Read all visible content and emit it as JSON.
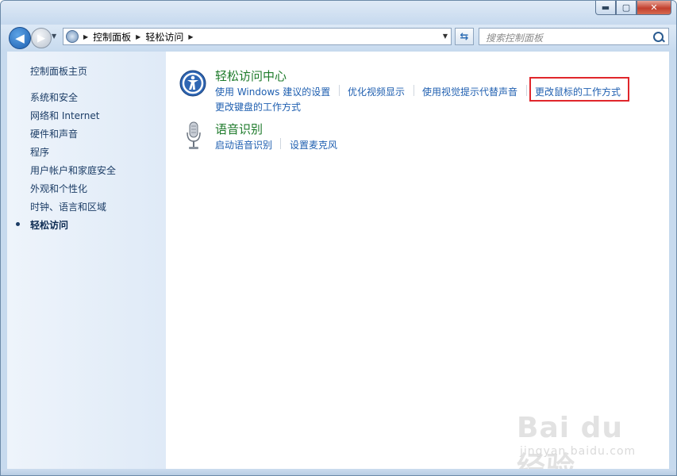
{
  "window": {
    "caption_buttons": {
      "minimize": "▬",
      "maximize": "▢",
      "close": "✕"
    }
  },
  "toolbar": {
    "breadcrumb": [
      "控制面板",
      "轻松访问"
    ],
    "search_placeholder": "搜索控制面板"
  },
  "sidebar": {
    "home": "控制面板主页",
    "items": [
      {
        "label": "系统和安全"
      },
      {
        "label": "网络和 Internet"
      },
      {
        "label": "硬件和声音"
      },
      {
        "label": "程序"
      },
      {
        "label": "用户帐户和家庭安全"
      },
      {
        "label": "外观和个性化"
      },
      {
        "label": "时钟、语言和区域"
      },
      {
        "label": "轻松访问",
        "active": true
      }
    ]
  },
  "main": {
    "categories": [
      {
        "title": "轻松访问中心",
        "icon": "ease-of-access-icon",
        "tasks": [
          "使用 Windows 建议的设置",
          "优化视频显示",
          "使用视觉提示代替声音",
          "更改鼠标的工作方式",
          "更改键盘的工作方式"
        ]
      },
      {
        "title": "语音识别",
        "icon": "microphone-icon",
        "tasks": [
          "启动语音识别",
          "设置麦克风"
        ]
      }
    ],
    "highlight_color": "#e0262b"
  },
  "watermark": {
    "brand": "Bai du 经验",
    "sub": "jingyan.baidu.com"
  }
}
